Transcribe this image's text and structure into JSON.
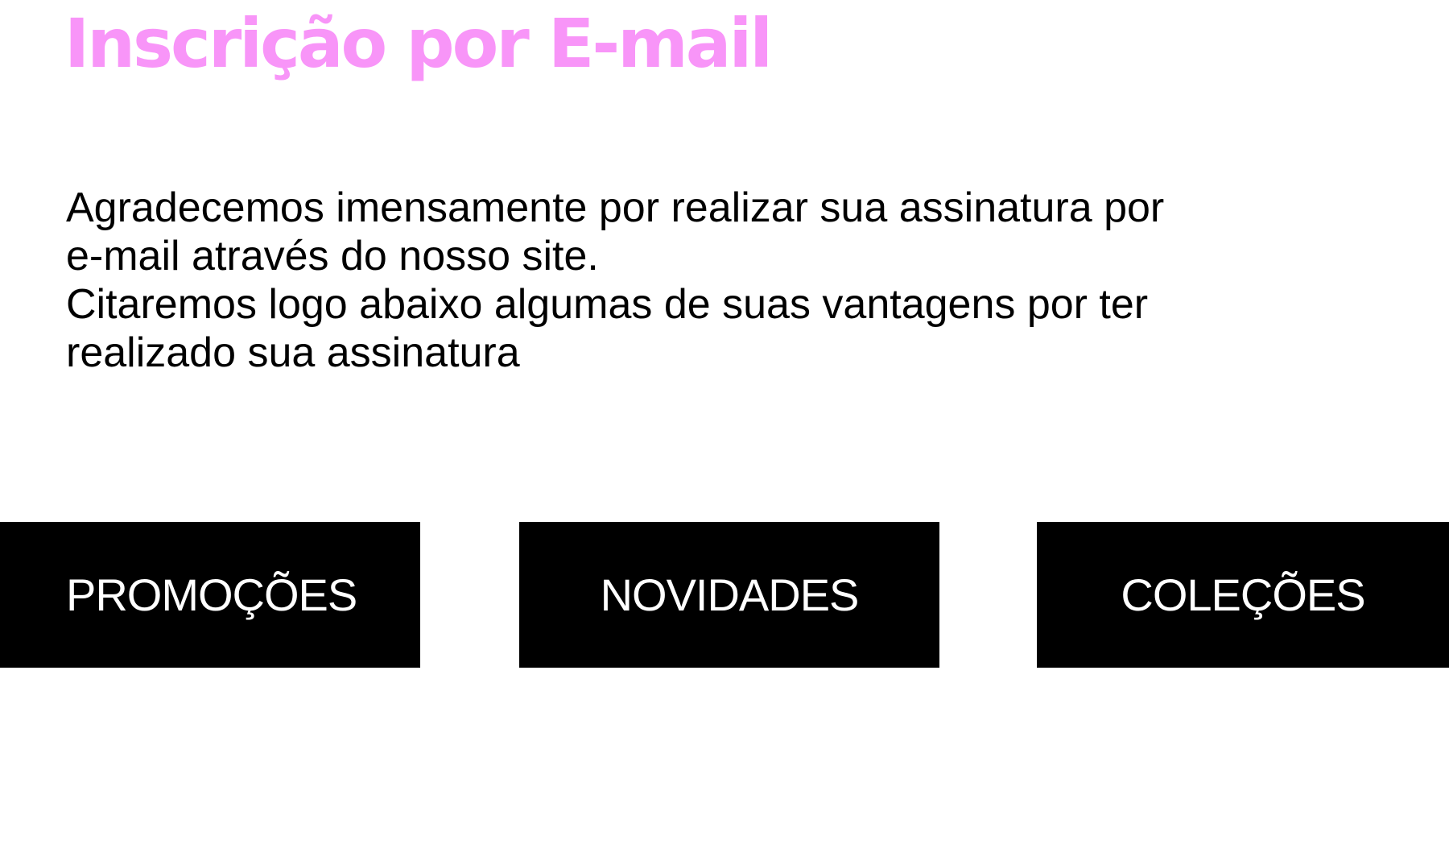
{
  "header": {
    "title": "Inscrição por E-mail",
    "title_color": "#F895F8"
  },
  "intro": {
    "line1": "Agradecemos imensamente por realizar sua assinatura por",
    "line2": "e-mail através do nosso site.",
    "line3": "Citaremos logo abaixo algumas de suas vantagens por ter",
    "line4": "realizado sua assinatura"
  },
  "benefits": {
    "button_bg": "#000000",
    "button_fg": "#FFFFFF",
    "items": [
      {
        "label": "PROMOÇÕES"
      },
      {
        "label": "NOVIDADES"
      },
      {
        "label": "COLEÇÕES"
      }
    ]
  }
}
